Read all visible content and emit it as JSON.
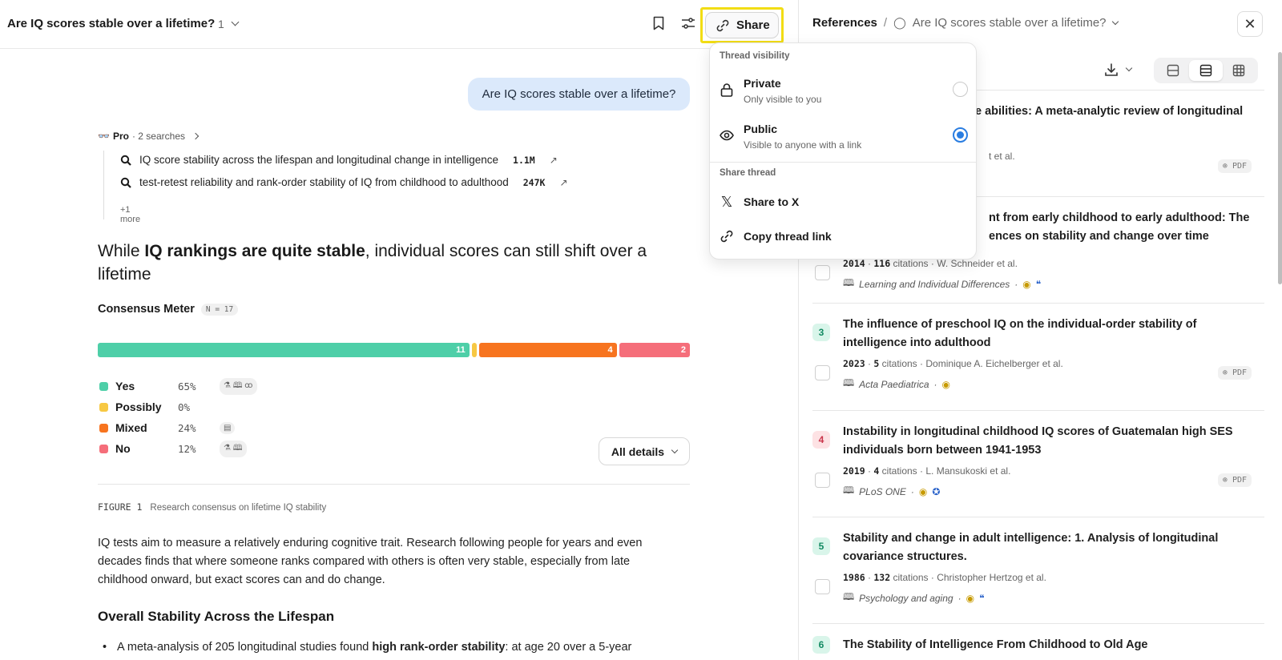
{
  "thread": {
    "title": "Are IQ scores stable over a lifetime?",
    "count": "1",
    "share_label": "Share"
  },
  "question": "Are IQ scores stable over a lifetime?",
  "pro": {
    "label": "Pro",
    "searches": "· 2 searches",
    "items": [
      {
        "text": "IQ score stability across the lifespan and longitudinal change in intelligence",
        "count": "1.1M"
      },
      {
        "text": "test-retest reliability and rank-order stability of IQ from childhood to adulthood",
        "count": "247K"
      }
    ],
    "more": "+1 more"
  },
  "headline": {
    "pre": "While ",
    "bold": "IQ rankings are quite stable",
    "post": ", individual scores can still shift over a lifetime"
  },
  "consensus": {
    "title": "Consensus Meter",
    "n": "N = 17",
    "segments": [
      {
        "label": "Yes",
        "count": 11,
        "pct": "65%",
        "color": "#4ecfa8",
        "chips": "⚗ 🕮 ꝏ"
      },
      {
        "label": "Possibly",
        "count": 0,
        "pct": "0%",
        "color": "#f7c843",
        "chips": ""
      },
      {
        "label": "Mixed",
        "count": 4,
        "pct": "24%",
        "color": "#f7741f",
        "chips": "▤"
      },
      {
        "label": "No",
        "count": 2,
        "pct": "12%",
        "color": "#f56e7a",
        "chips": "⚗ 🕮"
      }
    ],
    "all_details": "All details"
  },
  "figure": {
    "id": "FIGURE 1",
    "caption": "Research consensus on lifetime IQ stability"
  },
  "paragraph": "IQ tests aim to measure a relatively enduring cognitive trait. Research following people for years and even decades finds that where someone ranks compared with others is often very stable, especially from late childhood onward, but exact scores can and do change.",
  "section_heading": "Overall Stability Across the Lifespan",
  "bullet": {
    "pre": "A meta-analysis of 205 longitudinal studies found ",
    "bold": "high rank-order stability",
    "post": ": at age 20 over a 5-year"
  },
  "share_menu": {
    "visibility_label": "Thread visibility",
    "private": {
      "title": "Private",
      "desc": "Only visible to you"
    },
    "public": {
      "title": "Public",
      "desc": "Visible to anyone with a link"
    },
    "share_label": "Share thread",
    "share_x": "Share to X",
    "copy_link": "Copy thread link"
  },
  "references": {
    "label": "References",
    "separator": "/",
    "thread": "Are IQ scores stable over a lifetime?",
    "items": [
      {
        "num": "",
        "title": "e abilities: A meta-analytic review of longitudinal",
        "year": "",
        "cites": "",
        "authors": "t et al.",
        "journal": "",
        "pdf": "PDF"
      },
      {
        "num": "",
        "title": "nt from early childhood to early adulthood: The",
        "title2": "ences on stability and change over time",
        "year": "2014",
        "cites": "116",
        "authors": "W. Schneider et al.",
        "journal": "Learning and Individual Differences",
        "pdf": ""
      },
      {
        "num": "3",
        "title": "The influence of preschool IQ on the individual-order stability of intelligence into adulthood",
        "year": "2023",
        "cites": "5",
        "authors": "Dominique A. Eichelberger et al.",
        "journal": "Acta Paediatrica",
        "pdf": "PDF"
      },
      {
        "num": "4",
        "title": "Instability in longitudinal childhood IQ scores of Guatemalan high SES individuals born between 1941-1953",
        "year": "2019",
        "cites": "4",
        "authors": "L. Mansukoski et al.",
        "journal": "PLoS ONE",
        "pdf": "PDF"
      },
      {
        "num": "5",
        "title": "Stability and change in adult intelligence: 1. Analysis of longitudinal covariance structures.",
        "year": "1986",
        "cites": "132",
        "authors": "Christopher Hertzog et al.",
        "journal": "Psychology and aging",
        "pdf": ""
      },
      {
        "num": "6",
        "title": "The Stability of Intelligence From Childhood to Old Age"
      }
    ],
    "citations_word": "citations",
    "close": "✕"
  }
}
